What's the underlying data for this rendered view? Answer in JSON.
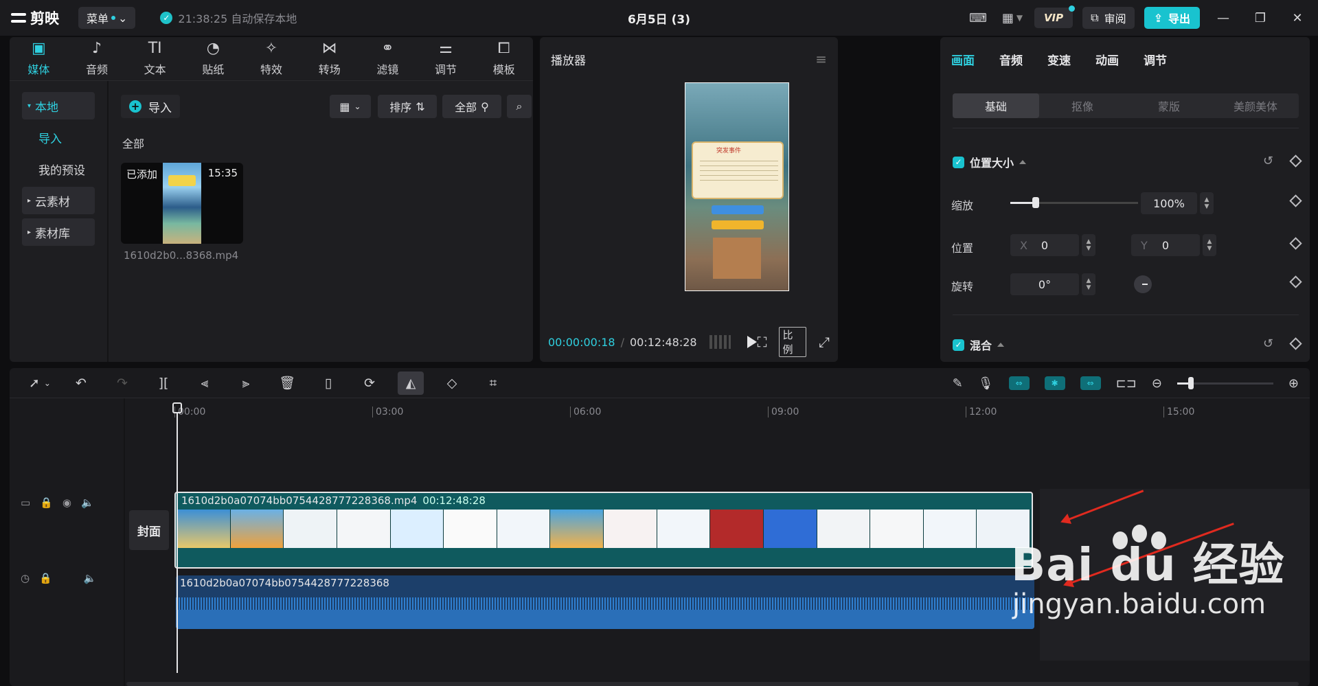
{
  "app": {
    "name": "剪映",
    "menu_label": "菜单",
    "autosave": "21:38:25 自动保存本地",
    "doc_title": "6月5日 (3)",
    "vip": "VIP",
    "review": "审阅",
    "export": "导出"
  },
  "media_tabs": [
    {
      "label": "媒体",
      "icon": "media-icon"
    },
    {
      "label": "音频",
      "icon": "audio-icon"
    },
    {
      "label": "文本",
      "icon": "text-icon"
    },
    {
      "label": "贴纸",
      "icon": "sticker-icon"
    },
    {
      "label": "特效",
      "icon": "effects-icon"
    },
    {
      "label": "转场",
      "icon": "transition-icon"
    },
    {
      "label": "滤镜",
      "icon": "filter-icon"
    },
    {
      "label": "调节",
      "icon": "adjust-icon"
    },
    {
      "label": "模板",
      "icon": "template-icon"
    }
  ],
  "media_side": {
    "local": "本地",
    "import": "导入",
    "presets": "我的预设",
    "cloud": "云素材",
    "library": "素材库"
  },
  "media_toolbar": {
    "import": "导入",
    "sort": "排序",
    "filter_all": "全部",
    "all_label": "全部"
  },
  "media_item": {
    "added": "已添加",
    "duration": "15:35",
    "name": "1610d2b0...8368.mp4"
  },
  "player": {
    "title": "播放器",
    "current": "00:00:00:18",
    "total": "00:12:48:28",
    "ratio": "比例",
    "dialog_title": "突发事件"
  },
  "props": {
    "tabs": [
      "画面",
      "音频",
      "变速",
      "动画",
      "调节"
    ],
    "sub_tabs": [
      "基础",
      "抠像",
      "蒙版",
      "美颜美体"
    ],
    "position_size": "位置大小",
    "scale_label": "缩放",
    "scale_value": "100%",
    "scale_fraction": 0.2,
    "position_label": "位置",
    "x_label": "X",
    "x_value": "0",
    "y_label": "Y",
    "y_value": "0",
    "rotate_label": "旋转",
    "rotate_value": "0°",
    "blend": "混合"
  },
  "timeline": {
    "ruler": [
      "00:00",
      "03:00",
      "06:00",
      "09:00",
      "12:00",
      "15:00"
    ],
    "cover": "封面",
    "video_clip_name": "1610d2b0a07074bb0754428777228368.mp4",
    "video_clip_duration": "00:12:48:28",
    "audio_clip_name": "1610d2b0a07074bb0754428777228368"
  },
  "watermark": {
    "main": "Bai du 经验",
    "sub": "jingyan.baidu.com"
  },
  "colors": {
    "accent": "#2fd0e0",
    "export_bg": "#19c3cf",
    "video_clip": "#0f5a5e",
    "audio_clip": "#1c3f6a",
    "arrow": "#e02a1f"
  }
}
